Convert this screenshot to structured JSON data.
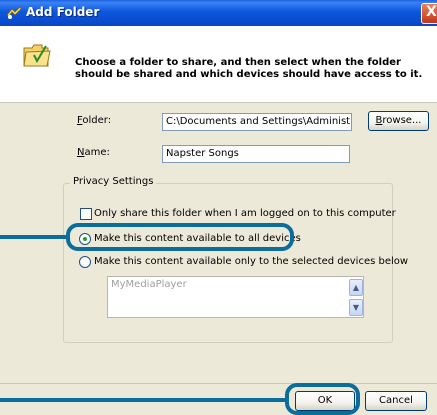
{
  "window": {
    "title": "Add Folder",
    "close_label": "X"
  },
  "header": {
    "instructions": "Choose a folder to share, and then select when the folder should be shared and which devices should have access to it."
  },
  "form": {
    "folder_label_first": "F",
    "folder_label_rest": "older:",
    "folder_value": "C:\\Documents and Settings\\Administrat",
    "browse_label_first": "B",
    "browse_label_rest": "rowse...",
    "name_label_first": "N",
    "name_label_rest": "ame:",
    "name_value": "Napster Songs"
  },
  "privacy": {
    "legend": "Privacy Settings",
    "only_logged_on": "Only share this folder when I am logged on to this computer",
    "all_devices": "Make this content available to all devices",
    "selected_devices": "Make this content available only to the selected devices below",
    "device_list": [
      "MyMediaPlayer"
    ],
    "selected_option": "all_devices"
  },
  "buttons": {
    "ok": "OK",
    "cancel": "Cancel"
  },
  "colors": {
    "titlebar": "#0a4bcd",
    "callout": "#0a6d9c",
    "dialog_bg": "#ece9d8"
  }
}
